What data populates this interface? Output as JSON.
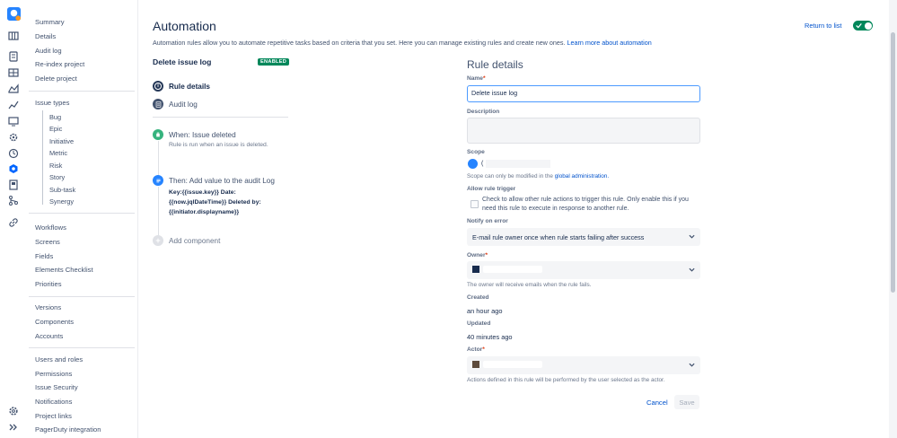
{
  "sidebar": {
    "top_links": [
      "Summary",
      "Details",
      "Audit log",
      "Re-index project",
      "Delete project"
    ],
    "issue_types_label": "Issue types",
    "issue_types": [
      "Bug",
      "Epic",
      "Initiative",
      "Metric",
      "Risk",
      "Story",
      "Sub-task",
      "Synergy"
    ],
    "group2": [
      "Workflows",
      "Screens",
      "Fields",
      "Elements Checklist",
      "Priorities"
    ],
    "group3": [
      "Versions",
      "Components",
      "Accounts"
    ],
    "group4": [
      "Users and roles",
      "Permissions",
      "Issue Security",
      "Notifications",
      "Project links",
      "PagerDuty integration"
    ]
  },
  "header": {
    "title": "Automation",
    "description": "Automation rules allow you to automate repetitive tasks based on criteria that you set. Here you can manage existing rules and create new ones.",
    "learn_more": "Learn more about automation",
    "return_link": "Return to list"
  },
  "rule": {
    "name": "Delete issue log",
    "status": "ENABLED",
    "nav": [
      "Rule details",
      "Audit log"
    ],
    "trigger_title": "When: Issue deleted",
    "trigger_desc": "Rule is run when an issue is deleted.",
    "action_title": "Then: Add value to the audit Log",
    "action_body_1": "Key:{{issue.key}} Date:",
    "action_body_2": "{{now.jqlDateTime}} Deleted by:",
    "action_body_3": "{{initiator.displayname}}",
    "add_component": "Add component"
  },
  "details": {
    "title": "Rule details",
    "name_label": "Name",
    "name_value": "Delete issue log",
    "description_label": "Description",
    "scope_label": "Scope",
    "scope_value_prefix": "(",
    "scope_note": "Scope can only be modified in the",
    "scope_note_link": "global administration.",
    "allow_trigger_label": "Allow rule trigger",
    "allow_trigger_text": "Check to allow other rule actions to trigger this rule. Only enable this if you need this rule to execute in response to another rule.",
    "notify_label": "Notify on error",
    "notify_value": "E-mail rule owner once when rule starts failing after success",
    "owner_label": "Owner",
    "owner_note": "The owner will receive emails when the rule fails.",
    "created_label": "Created",
    "created_value": "an hour ago",
    "updated_label": "Updated",
    "updated_value": "40 minutes ago",
    "actor_label": "Actor",
    "actor_note": "Actions defined in this rule will be performed by the user selected as the actor.",
    "cancel": "Cancel",
    "save": "Save",
    "required_mark": "*"
  },
  "colors": {
    "accent": "#0052cc",
    "toggle": "#00875a",
    "enabled_badge": "#00875a"
  },
  "icons": [
    "app-logo",
    "board-icon",
    "backlog-icon",
    "reports-icon",
    "releases-icon",
    "components-icon",
    "chart-icon",
    "issues-icon",
    "settings-icon",
    "time-icon",
    "bitbucket-icon",
    "pages-icon",
    "git-icon",
    "link-icon",
    "gear-icon",
    "expand-icon"
  ]
}
